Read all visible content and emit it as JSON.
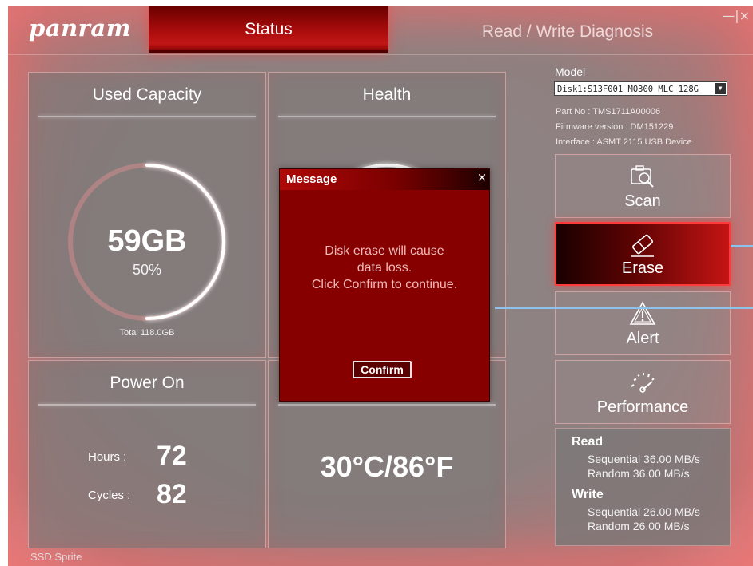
{
  "app": {
    "logo": "panram",
    "footer": "SSD Sprite",
    "window_controls": "—|×"
  },
  "tabs": [
    {
      "label": "Status",
      "active": true
    },
    {
      "label": "Read / Write Diagnosis",
      "active": false
    }
  ],
  "capacity": {
    "title": "Used Capacity",
    "value": "59GB",
    "percent_label": "50%",
    "used_fraction": 0.5,
    "total": "Total 118.0GB"
  },
  "health": {
    "title": "Health"
  },
  "power_on": {
    "title": "Power On",
    "hours_label": "Hours :",
    "hours_value": "72",
    "cycles_label": "Cycles :",
    "cycles_value": "82"
  },
  "temperature": {
    "value": "30°C/86°F"
  },
  "model": {
    "label": "Model",
    "selected": "Disk1:S13F001 MO300 MLC 128G",
    "part_no": "Part No : TMS1711A00006",
    "firmware": "Firmware version : DM151229",
    "interface": "Interface : ASMT 2115 USB Device"
  },
  "actions": {
    "scan": "Scan",
    "erase": "Erase",
    "alert": "Alert",
    "performance": "Performance"
  },
  "speed": {
    "read_title": "Read",
    "read_seq": "Sequential 36.00 MB/s",
    "read_rand": "Random 36.00 MB/s",
    "write_title": "Write",
    "write_seq": "Sequential 26.00 MB/s",
    "write_rand": "Random 26.00 MB/s"
  },
  "dialog": {
    "title": "Message",
    "close": "×",
    "line1": "Disk erase will cause",
    "line2": "data loss.",
    "line3": "Click Confirm to continue.",
    "confirm": "Confirm"
  },
  "colors": {
    "accent_red": "#c21616",
    "dialog_bg": "#860000",
    "highlight_blue": "#8cc3ee"
  }
}
